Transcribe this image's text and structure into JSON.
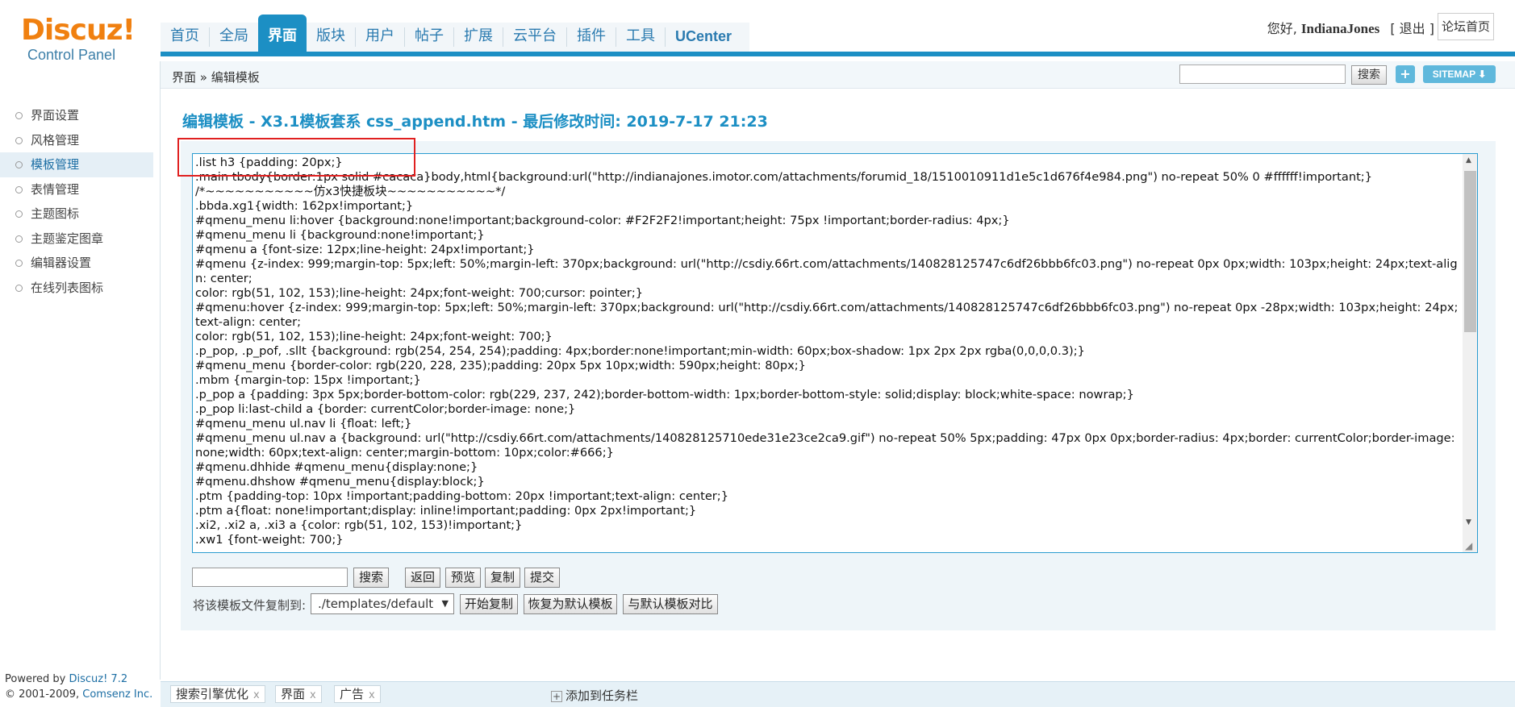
{
  "logo": {
    "brand": "Discuz!",
    "subtitle": "Control Panel"
  },
  "nav": {
    "items": [
      "首页",
      "全局",
      "界面",
      "版块",
      "用户",
      "帖子",
      "扩展",
      "云平台",
      "插件",
      "工具",
      "UCenter"
    ],
    "active": "界面"
  },
  "user": {
    "greeting": "您好,",
    "name": "IndianaJones",
    "logout": "[ 退出 ]",
    "home": "论坛首页"
  },
  "breadcrumb": "界面 » 编辑模板",
  "top_search": {
    "value": "",
    "button": "搜索",
    "plus": "+",
    "sitemap": "SITEMAP ⬇"
  },
  "sidebar": {
    "items": [
      "界面设置",
      "风格管理",
      "模板管理",
      "表情管理",
      "主题图标",
      "主题鉴定图章",
      "编辑器设置",
      "在线列表图标"
    ],
    "active": "模板管理"
  },
  "powered": {
    "line1_prefix": "Powered by ",
    "line1_link": "Discuz! 7.2",
    "line2_prefix": "© 2001-2009, ",
    "line2_link": "Comsenz Inc."
  },
  "page_title": "编辑模板 - X3.1模板套系 css_append.htm - 最后修改时间: 2019-7-17 21:23",
  "editor": {
    "lines": [
      ".list h3 {padding: 20px;}",
      ".main tbody{border:1px solid #cacaca}body,html{background:url(\"http://indianajones.imotor.com/attachments/forumid_18/1510010911d1e5c1d676f4e984.png\") no-repeat 50% 0 #ffffff!important;}",
      "/*~~~~~~~~~~~仿x3快捷板块~~~~~~~~~~~*/",
      ".bbda.xg1{width: 162px!important;}",
      "#qmenu_menu li:hover {background:none!important;background-color: #F2F2F2!important;height: 75px !important;border-radius: 4px;}",
      "#qmenu_menu li {background:none!important;}",
      "#qmenu a {font-size: 12px;line-height: 24px!important;}",
      "#qmenu {z-index: 999;margin-top: 5px;left: 50%;margin-left: 370px;background: url(\"http://csdiy.66rt.com/attachments/140828125747c6df26bbb6fc03.png\") no-repeat 0px 0px;width: 103px;height: 24px;text-align: center;",
      "color: rgb(51, 102, 153);line-height: 24px;font-weight: 700;cursor: pointer;}",
      "#qmenu:hover {z-index: 999;margin-top: 5px;left: 50%;margin-left: 370px;background: url(\"http://csdiy.66rt.com/attachments/140828125747c6df26bbb6fc03.png\") no-repeat 0px -28px;width: 103px;height: 24px;text-align: center;",
      "color: rgb(51, 102, 153);line-height: 24px;font-weight: 700;}",
      ".p_pop, .p_pof, .sllt {background: rgb(254, 254, 254);padding: 4px;border:none!important;min-width: 60px;box-shadow: 1px 2px 2px rgba(0,0,0,0.3);}",
      "#qmenu_menu {border-color: rgb(220, 228, 235);padding: 20px 5px 10px;width: 590px;height: 80px;}",
      ".mbm {margin-top: 15px !important;}",
      ".p_pop a {padding: 3px 5px;border-bottom-color: rgb(229, 237, 242);border-bottom-width: 1px;border-bottom-style: solid;display: block;white-space: nowrap;}",
      ".p_pop li:last-child a {border: currentColor;border-image: none;}",
      "#qmenu_menu ul.nav li {float: left;}",
      "#qmenu_menu ul.nav a {background: url(\"http://csdiy.66rt.com/attachments/140828125710ede31e23ce2ca9.gif\") no-repeat 50% 5px;padding: 47px 0px 0px;border-radius: 4px;border: currentColor;border-image: none;width: 60px;text-align: center;margin-bottom: 10px;color:#666;}",
      "#qmenu.dhhide #qmenu_menu{display:none;}",
      "#qmenu.dhshow #qmenu_menu{display:block;}",
      ".ptm {padding-top: 10px !important;padding-bottom: 20px !important;text-align: center;}",
      ".ptm a{float: none!important;display: inline!important;padding: 0px 2px!important;}",
      ".xi2, .xi2 a, .xi3 a {color: rgb(51, 102, 153)!important;}",
      ".xw1 {font-weight: 700;}"
    ]
  },
  "bottom": {
    "search_value": "",
    "search_button": "搜索",
    "back": "返回",
    "preview": "预览",
    "copy": "复制",
    "submit": "提交",
    "copy_label": "将该模板文件复制到:",
    "select_value": "./templates/default",
    "start_copy": "开始复制",
    "restore": "恢复为默认模板",
    "compare": "与默认模板对比"
  },
  "taskbar": {
    "tabs": [
      "搜索引擎优化",
      "界面",
      "广告"
    ],
    "add": "添加到任务栏"
  },
  "colors": {
    "accent": "#1c8fc4",
    "logo": "#f08010",
    "highlight": "#e02020"
  }
}
